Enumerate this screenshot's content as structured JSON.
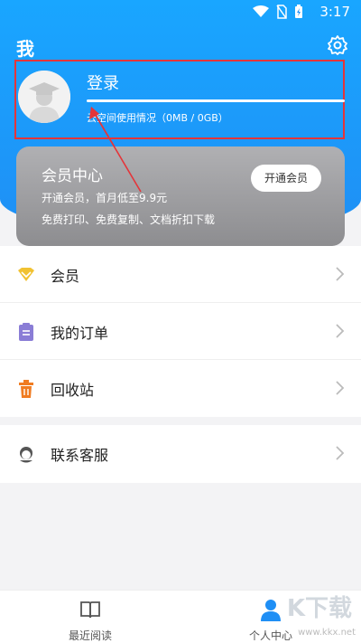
{
  "status_bar": {
    "time": "3:17"
  },
  "header": {
    "title": "我"
  },
  "account": {
    "login_label": "登录",
    "storage_usage": "云空间使用情况（0MB / 0GB）",
    "storage_fraction": 0
  },
  "vip_card": {
    "title": "会员中心",
    "promo": "开通会员，首月低至9.9元",
    "benefits": "免费打印、免费复制、文档折扣下载",
    "cta_label": "开通会员"
  },
  "menu": {
    "items": [
      {
        "label": "会员",
        "icon": "diamond-icon"
      },
      {
        "label": "我的订单",
        "icon": "clipboard-icon"
      },
      {
        "label": "回收站",
        "icon": "trash-icon"
      }
    ]
  },
  "support": {
    "label": "联系客服",
    "icon": "headset-icon"
  },
  "bottom_nav": {
    "items": [
      {
        "label": "最近阅读",
        "icon": "book-icon"
      },
      {
        "label": "个人中心",
        "icon": "person-icon"
      }
    ]
  },
  "watermark": {
    "logo_text": "K下载",
    "url": "www.kkx.net"
  },
  "colors": {
    "hero_blue": "#1f8ff5",
    "highlight_red": "#e4353a",
    "vip_gray": "#9e9ea1",
    "diamond_gold": "#f1c232",
    "order_purple": "#8a7dd6",
    "trash_orange": "#f07c22"
  }
}
